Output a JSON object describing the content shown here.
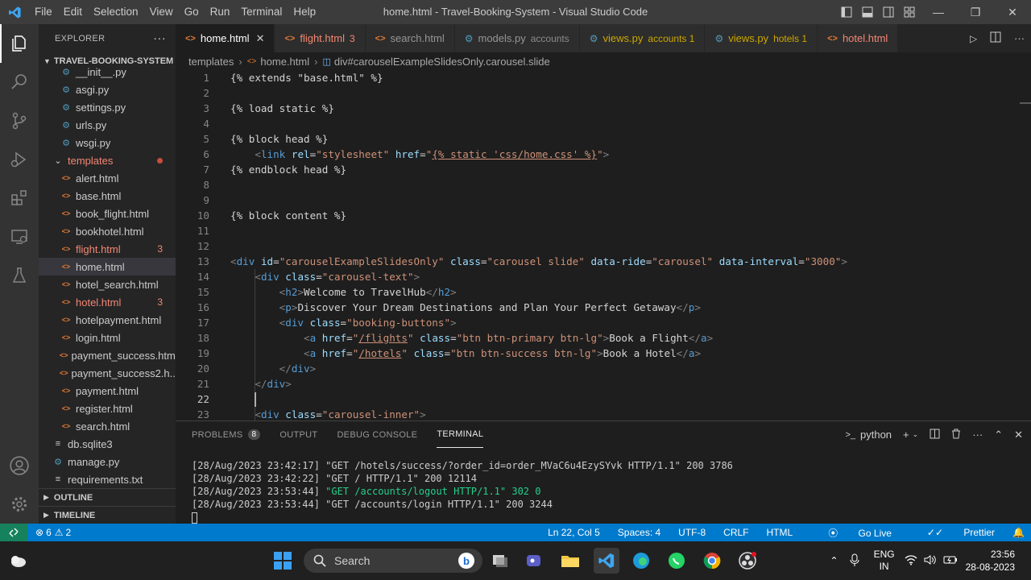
{
  "titlebar": {
    "menu": [
      "File",
      "Edit",
      "Selection",
      "View",
      "Go",
      "Run",
      "Terminal",
      "Help"
    ],
    "title": "home.html - Travel-Booking-System - Visual Studio Code"
  },
  "sidebar": {
    "header": "EXPLORER",
    "project": "TRAVEL-BOOKING-SYSTEM",
    "files_top": [
      "__init__.py",
      "asgi.py",
      "settings.py",
      "urls.py",
      "wsgi.py"
    ],
    "folder": "templates",
    "templates": [
      {
        "name": "alert.html",
        "badge": ""
      },
      {
        "name": "base.html",
        "badge": ""
      },
      {
        "name": "book_flight.html",
        "badge": ""
      },
      {
        "name": "bookhotel.html",
        "badge": ""
      },
      {
        "name": "flight.html",
        "badge": "3"
      },
      {
        "name": "home.html",
        "badge": ""
      },
      {
        "name": "hotel_search.html",
        "badge": ""
      },
      {
        "name": "hotel.html",
        "badge": "3"
      },
      {
        "name": "hotelpayment.html",
        "badge": ""
      },
      {
        "name": "login.html",
        "badge": ""
      },
      {
        "name": "payment_success.html",
        "badge": ""
      },
      {
        "name": "payment_success2.h...",
        "badge": ""
      },
      {
        "name": "payment.html",
        "badge": ""
      },
      {
        "name": "register.html",
        "badge": ""
      },
      {
        "name": "search.html",
        "badge": ""
      }
    ],
    "root_files": [
      "db.sqlite3",
      "manage.py",
      "requirements.txt"
    ],
    "outline": "OUTLINE",
    "timeline": "TIMELINE"
  },
  "tabs": [
    {
      "name": "home.html",
      "desc": "",
      "kind": "html",
      "state": "active"
    },
    {
      "name": "flight.html",
      "desc": "3",
      "kind": "html",
      "state": "err"
    },
    {
      "name": "search.html",
      "desc": "",
      "kind": "html",
      "state": ""
    },
    {
      "name": "models.py",
      "desc": "accounts",
      "kind": "py",
      "state": ""
    },
    {
      "name": "views.py",
      "desc": "accounts 1",
      "kind": "py",
      "state": "warn"
    },
    {
      "name": "views.py",
      "desc": "hotels 1",
      "kind": "py",
      "state": "warn"
    },
    {
      "name": "hotel.html",
      "desc": "",
      "kind": "html",
      "state": "err"
    }
  ],
  "breadcrumb": [
    "templates",
    "home.html",
    "div#carouselExampleSlidesOnly.carousel.slide"
  ],
  "editor": {
    "current_line": 22,
    "lines": [
      [
        [
          "tx",
          "{% extends \"base.html\" %}"
        ]
      ],
      [],
      [
        [
          "tx",
          "{% load static %}"
        ]
      ],
      [],
      [
        [
          "tx",
          "{% block head %}"
        ]
      ],
      [
        [
          "tx",
          "    "
        ],
        [
          "br",
          "<"
        ],
        [
          "tag",
          "link"
        ],
        [
          "tx",
          " "
        ],
        [
          "at",
          "rel"
        ],
        [
          "tx",
          "="
        ],
        [
          "st",
          "\"stylesheet\""
        ],
        [
          "tx",
          " "
        ],
        [
          "at",
          "href"
        ],
        [
          "tx",
          "="
        ],
        [
          "st",
          "\""
        ],
        [
          "stu",
          "{% static 'css/home.css' %}"
        ],
        [
          "st",
          "\""
        ],
        [
          "br",
          ">"
        ]
      ],
      [
        [
          "tx",
          "{% endblock head %}"
        ]
      ],
      [],
      [],
      [
        [
          "tx",
          "{% block content %}"
        ]
      ],
      [],
      [],
      [
        [
          "br",
          "<"
        ],
        [
          "tag",
          "div"
        ],
        [
          "tx",
          " "
        ],
        [
          "at",
          "id"
        ],
        [
          "tx",
          "="
        ],
        [
          "st",
          "\"carouselExampleSlidesOnly\""
        ],
        [
          "tx",
          " "
        ],
        [
          "at",
          "class"
        ],
        [
          "tx",
          "="
        ],
        [
          "st",
          "\"carousel slide\""
        ],
        [
          "tx",
          " "
        ],
        [
          "at",
          "data-ride"
        ],
        [
          "tx",
          "="
        ],
        [
          "st",
          "\"carousel\""
        ],
        [
          "tx",
          " "
        ],
        [
          "at",
          "data-interval"
        ],
        [
          "tx",
          "="
        ],
        [
          "st",
          "\"3000\""
        ],
        [
          "br",
          ">"
        ]
      ],
      [
        [
          "tx",
          "    "
        ],
        [
          "br",
          "<"
        ],
        [
          "tag",
          "div"
        ],
        [
          "tx",
          " "
        ],
        [
          "at",
          "class"
        ],
        [
          "tx",
          "="
        ],
        [
          "st",
          "\"carousel-text\""
        ],
        [
          "br",
          ">"
        ]
      ],
      [
        [
          "tx",
          "        "
        ],
        [
          "br",
          "<"
        ],
        [
          "tag",
          "h2"
        ],
        [
          "br",
          ">"
        ],
        [
          "tx",
          "Welcome to TravelHub"
        ],
        [
          "br",
          "</"
        ],
        [
          "tag",
          "h2"
        ],
        [
          "br",
          ">"
        ]
      ],
      [
        [
          "tx",
          "        "
        ],
        [
          "br",
          "<"
        ],
        [
          "tag",
          "p"
        ],
        [
          "br",
          ">"
        ],
        [
          "tx",
          "Discover Your Dream Destinations and Plan Your Perfect Getaway"
        ],
        [
          "br",
          "</"
        ],
        [
          "tag",
          "p"
        ],
        [
          "br",
          ">"
        ]
      ],
      [
        [
          "tx",
          "        "
        ],
        [
          "br",
          "<"
        ],
        [
          "tag",
          "div"
        ],
        [
          "tx",
          " "
        ],
        [
          "at",
          "class"
        ],
        [
          "tx",
          "="
        ],
        [
          "st",
          "\"booking-buttons\""
        ],
        [
          "br",
          ">"
        ]
      ],
      [
        [
          "tx",
          "            "
        ],
        [
          "br",
          "<"
        ],
        [
          "tag",
          "a"
        ],
        [
          "tx",
          " "
        ],
        [
          "at",
          "href"
        ],
        [
          "tx",
          "="
        ],
        [
          "st",
          "\""
        ],
        [
          "stu",
          "/flights"
        ],
        [
          "st",
          "\""
        ],
        [
          "tx",
          " "
        ],
        [
          "at",
          "class"
        ],
        [
          "tx",
          "="
        ],
        [
          "st",
          "\"btn btn-primary btn-lg\""
        ],
        [
          "br",
          ">"
        ],
        [
          "tx",
          "Book a Flight"
        ],
        [
          "br",
          "</"
        ],
        [
          "tag",
          "a"
        ],
        [
          "br",
          ">"
        ]
      ],
      [
        [
          "tx",
          "            "
        ],
        [
          "br",
          "<"
        ],
        [
          "tag",
          "a"
        ],
        [
          "tx",
          " "
        ],
        [
          "at",
          "href"
        ],
        [
          "tx",
          "="
        ],
        [
          "st",
          "\""
        ],
        [
          "stu",
          "/hotels"
        ],
        [
          "st",
          "\""
        ],
        [
          "tx",
          " "
        ],
        [
          "at",
          "class"
        ],
        [
          "tx",
          "="
        ],
        [
          "st",
          "\"btn btn-success btn-lg\""
        ],
        [
          "br",
          ">"
        ],
        [
          "tx",
          "Book a Hotel"
        ],
        [
          "br",
          "</"
        ],
        [
          "tag",
          "a"
        ],
        [
          "br",
          ">"
        ]
      ],
      [
        [
          "tx",
          "        "
        ],
        [
          "br",
          "</"
        ],
        [
          "tag",
          "div"
        ],
        [
          "br",
          ">"
        ]
      ],
      [
        [
          "tx",
          "    "
        ],
        [
          "br",
          "</"
        ],
        [
          "tag",
          "div"
        ],
        [
          "br",
          ">"
        ]
      ],
      [],
      [
        [
          "tx",
          "    "
        ],
        [
          "br",
          "<"
        ],
        [
          "tag",
          "div"
        ],
        [
          "tx",
          " "
        ],
        [
          "at",
          "class"
        ],
        [
          "tx",
          "="
        ],
        [
          "st",
          "\"carousel-inner\""
        ],
        [
          "br",
          ">"
        ]
      ]
    ]
  },
  "panel": {
    "tabs": [
      {
        "label": "PROBLEMS",
        "badge": "8"
      },
      {
        "label": "OUTPUT",
        "badge": ""
      },
      {
        "label": "DEBUG CONSOLE",
        "badge": ""
      },
      {
        "label": "TERMINAL",
        "badge": ""
      }
    ],
    "active_tab": "TERMINAL",
    "shell": "python",
    "terminal_lines": [
      {
        "text": "[28/Aug/2023 23:42:17] \"GET /hotels/success/?order_id=order_MVaC6u4EzySYvk HTTP/1.1\" 200 3786",
        "green": ""
      },
      {
        "text": "[28/Aug/2023 23:42:22] \"GET / HTTP/1.1\" 200 12114",
        "green": ""
      },
      {
        "text": "[28/Aug/2023 23:53:44] ",
        "green": "\"GET /accounts/logout HTTP/1.1\" 302 0"
      },
      {
        "text": "[28/Aug/2023 23:53:44] \"GET /accounts/login HTTP/1.1\" 200 3244",
        "green": ""
      }
    ]
  },
  "statusbar": {
    "errors": "6",
    "warnings": "2",
    "position": "Ln 22, Col 5",
    "spaces": "Spaces: 4",
    "encoding": "UTF-8",
    "eol": "CRLF",
    "language": "HTML",
    "golive": "Go Live",
    "prettier": "Prettier"
  },
  "taskbar": {
    "search_label": "Search",
    "lang_1": "ENG",
    "lang_2": "IN",
    "time": "23:56",
    "date": "28-08-2023"
  },
  "colors": {
    "accent": "#007acc",
    "editor_bg": "#1e1e1e",
    "sidebar_bg": "#252526",
    "error": "#f48771",
    "warning": "#cca700"
  }
}
